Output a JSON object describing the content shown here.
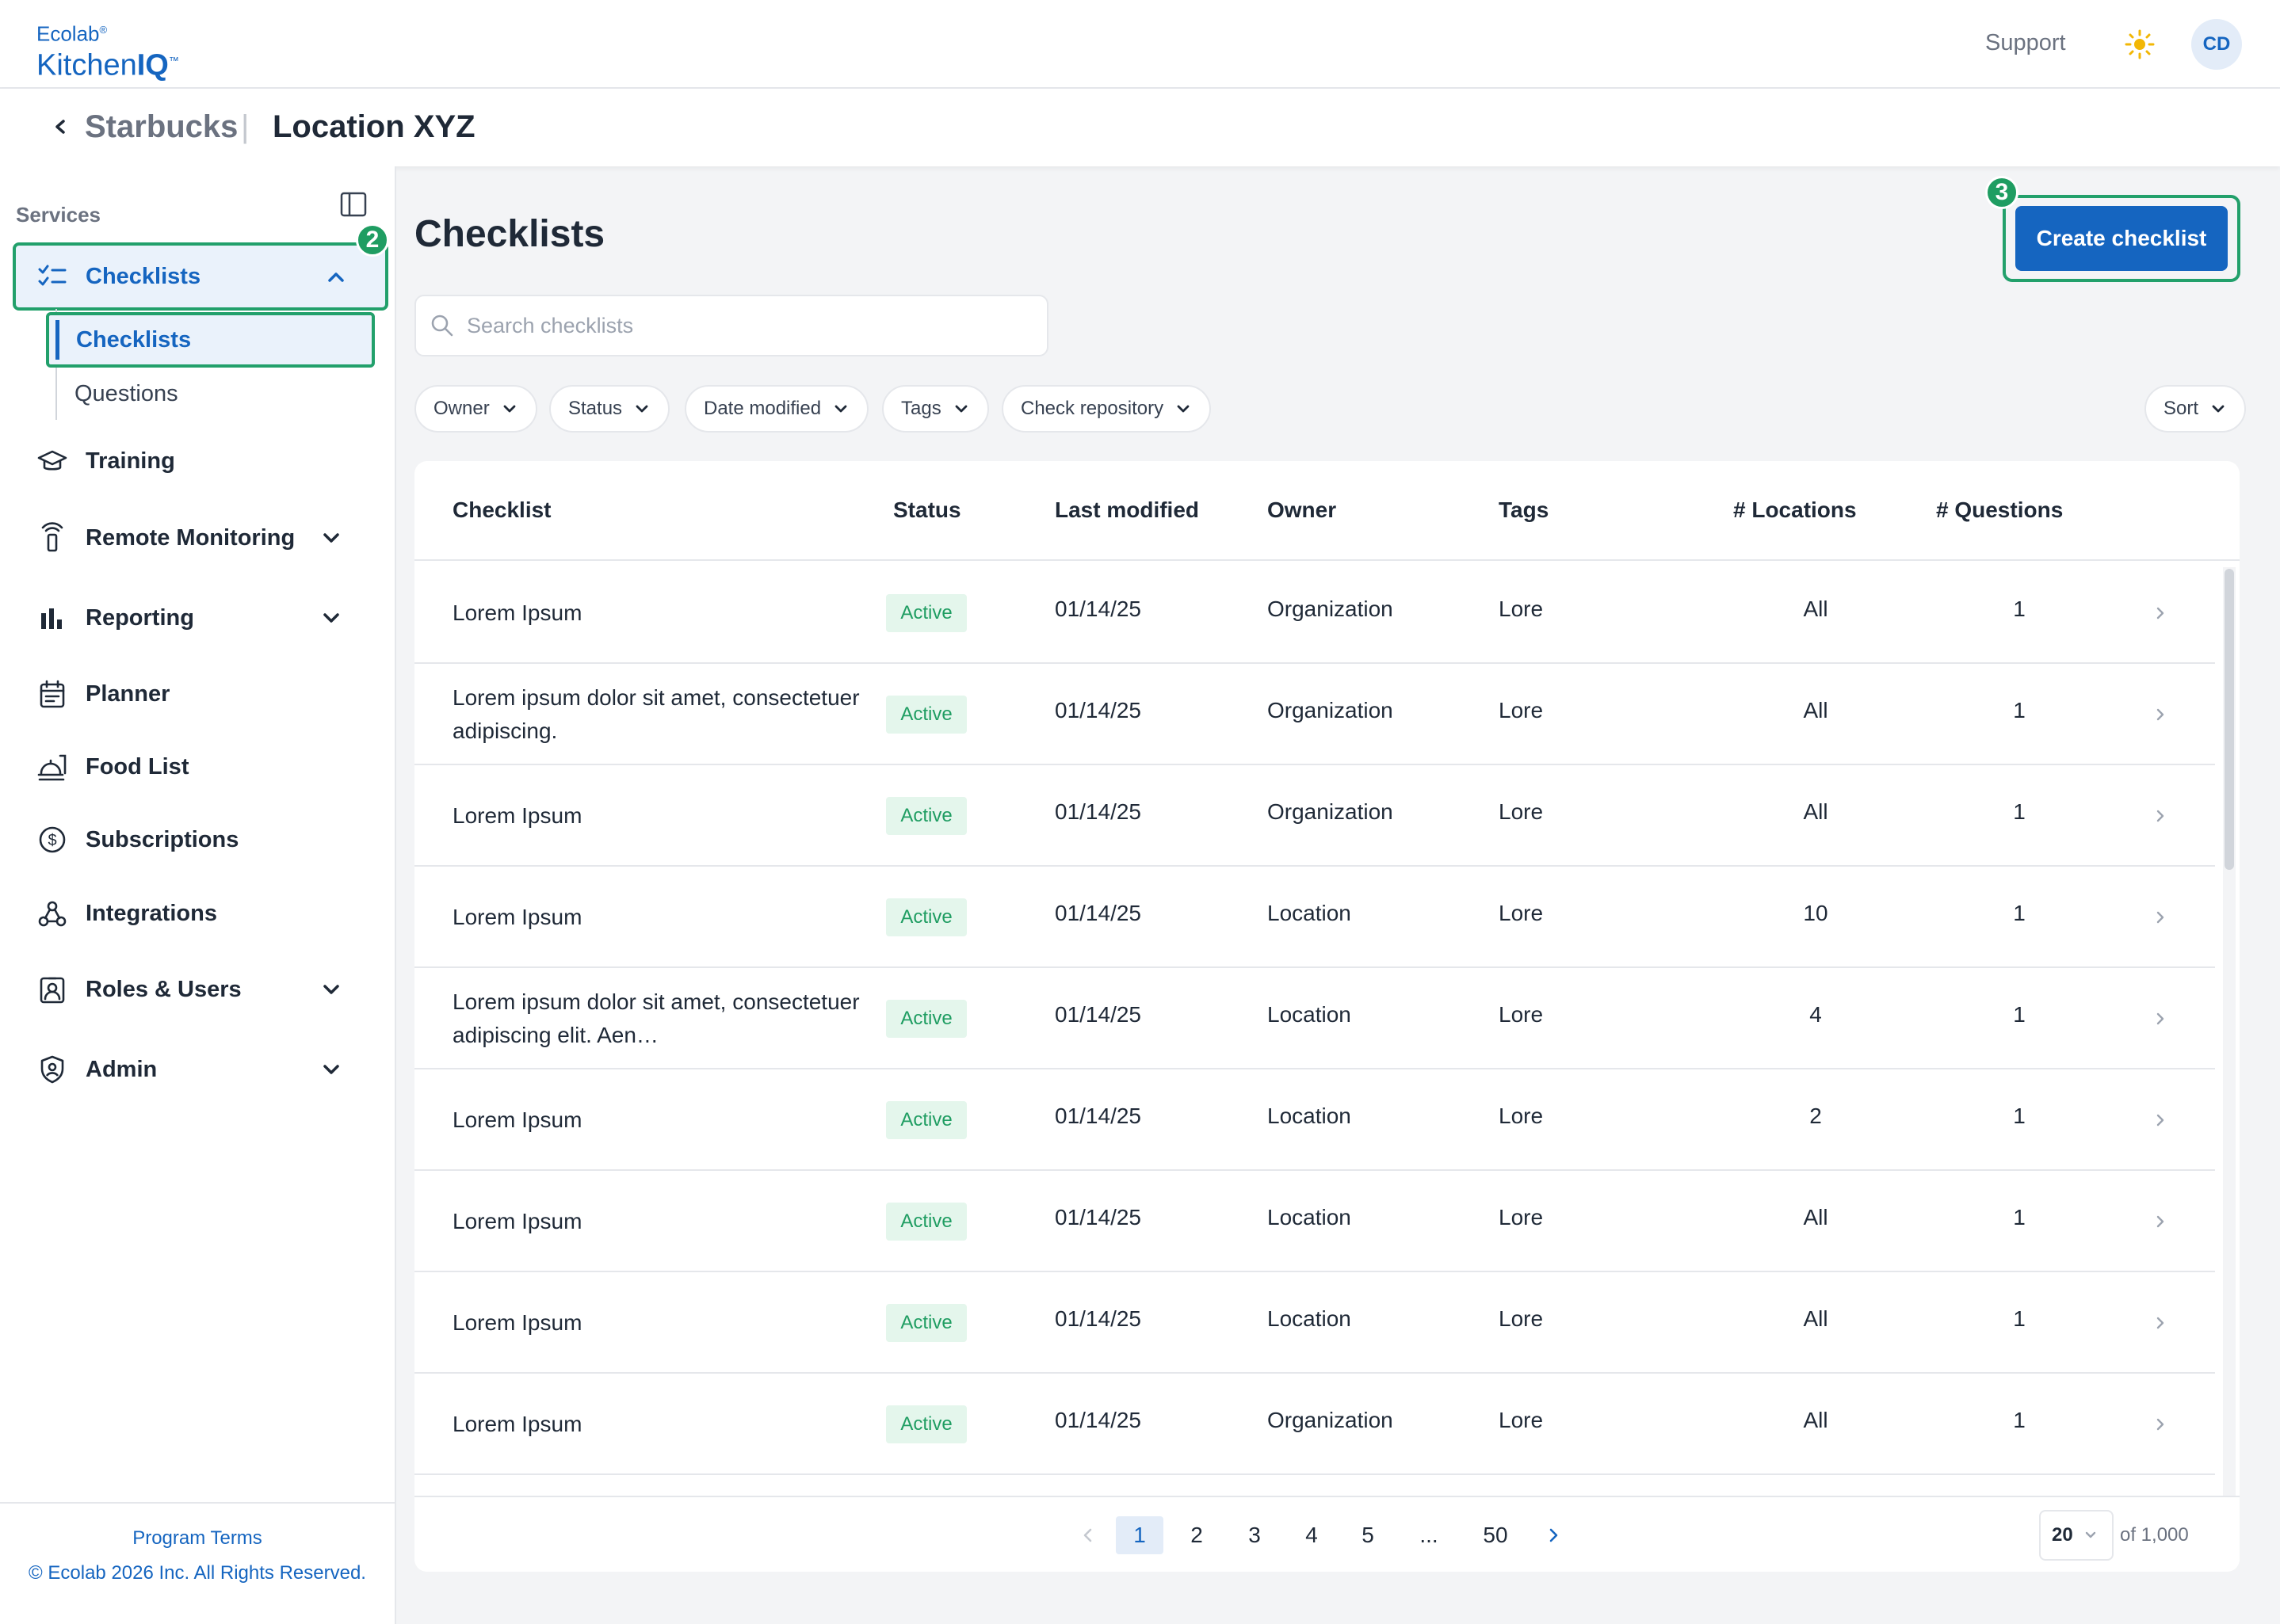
{
  "app": {
    "logo_line1": "Ecolab",
    "logo_line1_mark": "®",
    "logo_line2_a": "Kitchen",
    "logo_line2_b": "IQ",
    "logo_line2_mark": "™",
    "support": "Support",
    "avatar": "CD"
  },
  "breadcrumb": {
    "org": "Starbucks",
    "separator": "|",
    "location": "Location XYZ"
  },
  "sidebar": {
    "section_label": "Services",
    "items": [
      {
        "label": "Checklists",
        "icon": "checklist-icon",
        "active": true,
        "expanded": true
      },
      {
        "label": "Training",
        "icon": "graduation-cap-icon"
      },
      {
        "label": "Remote Monitoring",
        "icon": "sensor-icon",
        "has_dropdown": true
      },
      {
        "label": "Reporting",
        "icon": "bar-chart-icon",
        "has_dropdown": true
      },
      {
        "label": "Planner",
        "icon": "calendar-icon"
      },
      {
        "label": "Food List",
        "icon": "food-tray-icon"
      },
      {
        "label": "Subscriptions",
        "icon": "dollar-circle-icon"
      },
      {
        "label": "Integrations",
        "icon": "webhook-icon"
      },
      {
        "label": "Roles & Users",
        "icon": "id-badge-icon",
        "has_dropdown": true
      },
      {
        "label": "Admin",
        "icon": "shield-icon",
        "has_dropdown": true
      }
    ],
    "subitems": [
      {
        "label": "Checklists",
        "active": true
      },
      {
        "label": "Questions"
      }
    ],
    "footer": {
      "terms": "Program Terms",
      "copyright": "© Ecolab 2026 Inc. All Rights Reserved."
    }
  },
  "annotations": {
    "badge_sidebar": "2",
    "badge_create": "3"
  },
  "main": {
    "title": "Checklists",
    "create_button": "Create checklist",
    "search_placeholder": "Search checklists",
    "filters": [
      "Owner",
      "Status",
      "Date modified",
      "Tags",
      "Check repository"
    ],
    "sort_label": "Sort"
  },
  "table": {
    "columns": [
      "Checklist",
      "Status",
      "Last modified",
      "Owner",
      "Tags",
      "# Locations",
      "# Questions"
    ],
    "rows": [
      {
        "name": "Lorem Ipsum",
        "status": "Active",
        "modified": "01/14/25",
        "owner": "Organization",
        "tags": "Lore",
        "locations": "All",
        "questions": "1"
      },
      {
        "name": "Lorem ipsum dolor sit amet, consectetuer adipiscing.",
        "status": "Active",
        "modified": "01/14/25",
        "owner": "Organization",
        "tags": "Lore",
        "locations": "All",
        "questions": "1"
      },
      {
        "name": "Lorem Ipsum",
        "status": "Active",
        "modified": "01/14/25",
        "owner": "Organization",
        "tags": "Lore",
        "locations": "All",
        "questions": "1"
      },
      {
        "name": "Lorem Ipsum",
        "status": "Active",
        "modified": "01/14/25",
        "owner": "Location",
        "tags": "Lore",
        "locations": "10",
        "questions": "1"
      },
      {
        "name": "Lorem ipsum dolor sit amet, consectetuer adipiscing elit. Aen…",
        "status": "Active",
        "modified": "01/14/25",
        "owner": "Location",
        "tags": "Lore",
        "locations": "4",
        "questions": "1"
      },
      {
        "name": "Lorem Ipsum",
        "status": "Active",
        "modified": "01/14/25",
        "owner": "Location",
        "tags": "Lore",
        "locations": "2",
        "questions": "1"
      },
      {
        "name": "Lorem Ipsum",
        "status": "Active",
        "modified": "01/14/25",
        "owner": "Location",
        "tags": "Lore",
        "locations": "All",
        "questions": "1"
      },
      {
        "name": "Lorem Ipsum",
        "status": "Active",
        "modified": "01/14/25",
        "owner": "Location",
        "tags": "Lore",
        "locations": "All",
        "questions": "1"
      },
      {
        "name": "Lorem Ipsum",
        "status": "Active",
        "modified": "01/14/25",
        "owner": "Organization",
        "tags": "Lore",
        "locations": "All",
        "questions": "1"
      }
    ]
  },
  "pagination": {
    "pages": [
      "1",
      "2",
      "3",
      "4",
      "5",
      "...",
      "50"
    ],
    "current": "1",
    "per_page": "20",
    "total": "of 1,000"
  },
  "colors": {
    "brand": "#1565c0",
    "highlight": "#22a06b",
    "status_active_bg": "#e4f6ec",
    "status_active_text": "#1f9d62"
  }
}
